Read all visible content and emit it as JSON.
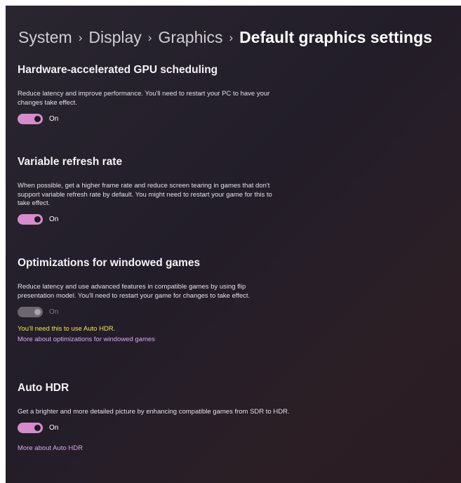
{
  "breadcrumb": {
    "items": [
      "System",
      "Display",
      "Graphics"
    ],
    "current": "Default graphics settings",
    "separator": "›"
  },
  "sections": [
    {
      "title": "Hardware-accelerated GPU scheduling",
      "description": "Reduce latency and improve performance. You'll need to restart your PC to have your changes take effect.",
      "toggle_label": "On",
      "toggle_state": "on"
    },
    {
      "title": "Variable refresh rate",
      "description": "When possible, get a higher frame rate and reduce screen tearing in games that don't support variable refresh rate by default. You might need to restart your game for this to take effect.",
      "toggle_label": "On",
      "toggle_state": "on"
    },
    {
      "title": "Optimizations for windowed games",
      "description": "Reduce latency and use advanced features in compatible games by using flip presentation model. You'll need to restart your game for changes to take effect.",
      "toggle_label": "On",
      "toggle_state": "on-disabled",
      "note": "You'll need this to use Auto HDR.",
      "link": "More about optimizations for windowed games"
    },
    {
      "title": "Auto HDR",
      "description": "Get a brighter and more detailed picture by enhancing compatible games from SDR to HDR.",
      "toggle_label": "On",
      "toggle_state": "on",
      "link": "More about Auto HDR"
    }
  ],
  "colors": {
    "accent": "#d68ccb",
    "note": "#f5e84a",
    "link": "#d9a9f0"
  }
}
